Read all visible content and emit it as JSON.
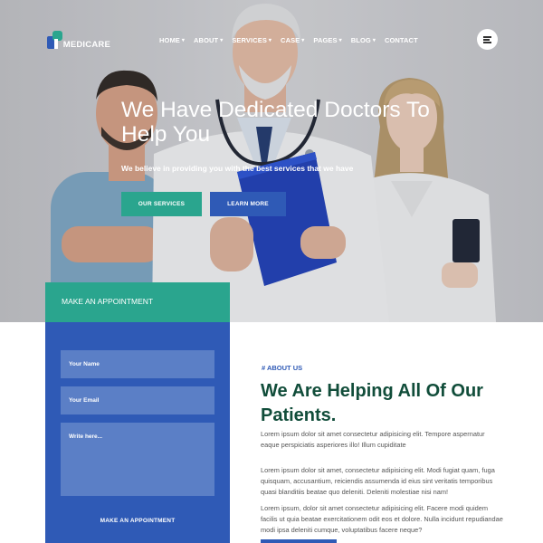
{
  "brand": {
    "name": "MEDICARE"
  },
  "nav": {
    "items": [
      {
        "label": "HOME",
        "caret": "▾"
      },
      {
        "label": "ABOUT",
        "caret": "▾"
      },
      {
        "label": "SERVICES",
        "caret": "▾"
      },
      {
        "label": "CASE",
        "caret": "▾"
      },
      {
        "label": "PAGES",
        "caret": "▾"
      },
      {
        "label": "BLOG",
        "caret": "▾"
      },
      {
        "label": "CONTACT",
        "caret": ""
      }
    ],
    "menu_icon": "hamburger-icon"
  },
  "hero": {
    "title": "We Have Dedicated Doctors To Help You",
    "subtitle": "We believe in providing you with the best services that we have",
    "primary_button": "OUR SERVICES",
    "secondary_button": "LEARN MORE"
  },
  "appointment": {
    "heading": "MAKE AN APPOINTMENT",
    "name_placeholder": "Your Name",
    "email_placeholder": "Your Email",
    "message_placeholder": "Write here...",
    "submit_label": "MAKE AN APPOINTMENT"
  },
  "about": {
    "tag": "# ABOUT US",
    "title": "We Are Helping All Of Our Patients.",
    "paragraphs": [
      "Lorem ipsum dolor sit amet consectetur adipisicing elit. Tempore aspernatur eaque perspiciatis asperiores illo! Illum cupiditate",
      "Lorem ipsum dolor sit amet, consectetur adipisicing elit. Modi fugiat quam, fuga quisquam, accusantium, reiciendis assumenda id eius sint veritatis temporibus quasi blanditiis beatae quo deleniti. Deleniti molestiae nisi nam!",
      "Lorem ipsum, dolor sit amet consectetur adipisicing elit. Facere modi quidem facilis ut quia beatae exercitationem odit eos et dolore. Nulla incidunt repudiandae modi ipsa deleniti cumque, voluptatibus facere neque?"
    ]
  },
  "colors": {
    "teal": "#2aa58e",
    "blue": "#2f5ab6",
    "field_blue": "#5b7fc6",
    "heading_green": "#114d3a"
  }
}
